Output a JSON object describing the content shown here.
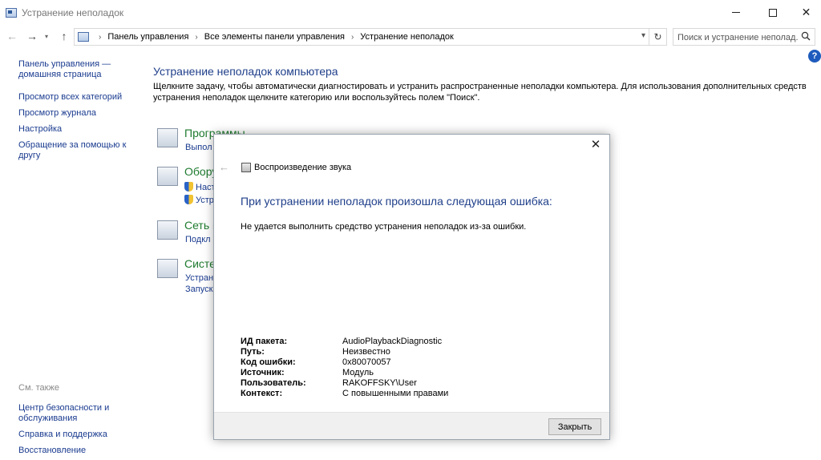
{
  "window": {
    "title": "Устранение неполадок"
  },
  "address": {
    "crumbs": [
      "Панель управления",
      "Все элементы панели управления",
      "Устранение неполадок"
    ]
  },
  "search": {
    "placeholder": "Поиск и устранение неполад..."
  },
  "sidebar": {
    "home": "Панель управления — домашняя страница",
    "items": [
      "Просмотр всех категорий",
      "Просмотр журнала",
      "Настройка",
      "Обращение за помощью к другу"
    ],
    "see_also_header": "См. также",
    "see_also": [
      "Центр безопасности и обслуживания",
      "Справка и поддержка",
      "Восстановление"
    ]
  },
  "main": {
    "title": "Устранение неполадок компьютера",
    "description": "Щелкните задачу, чтобы автоматически диагностировать и устранить распространенные неполадки компьютера. Для использования дополнительных средств устранения неполадок щелкните категорию или воспользуйтесь полем \"Поиск\".",
    "categories": [
      {
        "name": "Программы",
        "links": [
          "Выпол"
        ]
      },
      {
        "name": "Обору",
        "links": [
          "Наст",
          "Устр"
        ]
      },
      {
        "name": "Сеть и",
        "links": [
          "Подкл"
        ]
      },
      {
        "name": "Систе",
        "links": [
          "Устран",
          "Запуск"
        ]
      }
    ]
  },
  "dialog": {
    "app_title": "Воспроизведение звука",
    "heading": "При устранении неполадок произошла следующая ошибка:",
    "message": "Не удается выполнить средство устранения неполадок из-за ошибки.",
    "details": [
      {
        "key": "ИД пакета:",
        "value": "AudioPlaybackDiagnostic"
      },
      {
        "key": "Путь:",
        "value": "Неизвестно"
      },
      {
        "key": "Код ошибки:",
        "value": "0x80070057"
      },
      {
        "key": "Источник:",
        "value": "Модуль"
      },
      {
        "key": "Пользователь:",
        "value": "RAKOFFSKY\\User"
      },
      {
        "key": "Контекст:",
        "value": "С повышенными правами"
      }
    ],
    "close_label": "Закрыть"
  },
  "icons": {
    "help": "?",
    "close": "✕"
  }
}
